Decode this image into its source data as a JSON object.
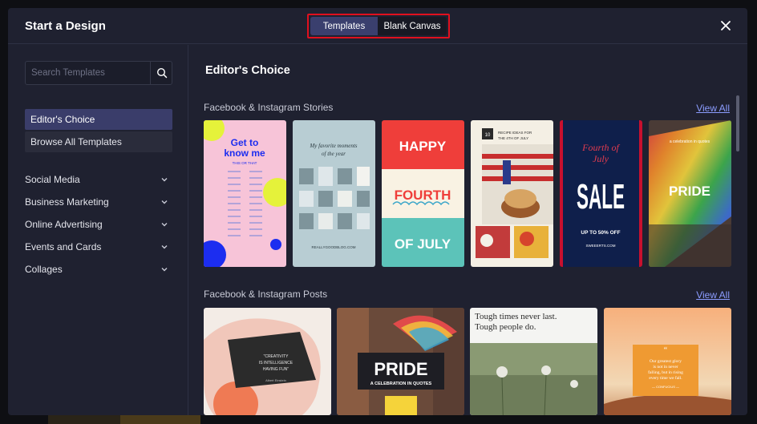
{
  "header": {
    "title": "Start a Design",
    "tabs": [
      {
        "label": "Templates",
        "active": true
      },
      {
        "label": "Blank Canvas",
        "active": false
      }
    ]
  },
  "sidebar": {
    "search_placeholder": "Search Templates",
    "nav": [
      {
        "label": "Editor's Choice",
        "active": true
      },
      {
        "label": "Browse All Templates",
        "active": false
      }
    ],
    "categories": [
      {
        "label": "Social Media"
      },
      {
        "label": "Business Marketing"
      },
      {
        "label": "Online Advertising"
      },
      {
        "label": "Events and Cards"
      },
      {
        "label": "Collages"
      }
    ]
  },
  "main": {
    "title": "Editor's Choice",
    "sections": [
      {
        "label": "Facebook & Instagram Stories",
        "view_all": "View All",
        "templates": [
          {
            "lines": [
              "Get to",
              "know me",
              "THIS OR THAT"
            ]
          },
          {
            "lines": [
              "My favorite moments",
              "of the year",
              "REALLYGOODBLOG.COM"
            ]
          },
          {
            "lines": [
              "HAPPY",
              "FOURTH",
              "OF JULY"
            ]
          },
          {
            "lines": [
              "10",
              "RECIPE IDEAS FOR",
              "THE 4TH OF JULY"
            ]
          },
          {
            "lines": [
              "Fourth of",
              "July",
              "SALE",
              "UP TO 50% OFF",
              "SWEEERTS.COM"
            ]
          },
          {
            "lines": [
              "a celebration in quotes",
              "PRIDE"
            ]
          }
        ]
      },
      {
        "label": "Facebook & Instagram Posts",
        "view_all": "View All",
        "templates": [
          {
            "lines": [
              "\"CREATIVITY",
              "IS INTELLIGENCE",
              "HAVING FUN\"",
              "Albert Einstein"
            ]
          },
          {
            "lines": [
              "PRIDE",
              "A CELEBRATION IN QUOTES"
            ]
          },
          {
            "lines": [
              "Tough times never last.",
              "Tough people do."
            ]
          },
          {
            "lines": [
              "Our greatest glory",
              "is not in never",
              "falling, but in rising",
              "every time we fall.",
              "— CONFUCIUS —"
            ]
          }
        ]
      }
    ]
  },
  "colors": {
    "modal_bg": "#1f2130",
    "accent": "#3a3d6a",
    "highlight_outline": "#e0101e",
    "link": "#8c9dff"
  }
}
